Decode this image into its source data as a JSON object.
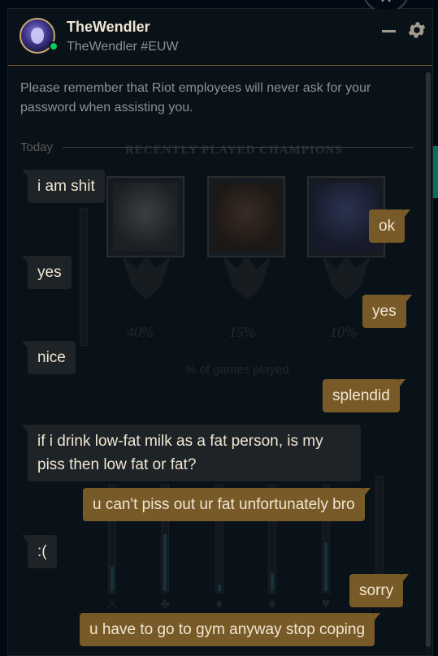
{
  "header": {
    "display_name": "TheWendler",
    "riot_id": "TheWendler #EUW",
    "status_color": "#0acb63",
    "minimize_icon": "minus-icon",
    "settings_icon": "gear-icon",
    "close_icon": "close-icon"
  },
  "notice": "Please remember that Riot employees will never ask for your password when assisting you.",
  "date_divider": "Today",
  "background_panel": {
    "title": "RECENTLY PLAYED CHAMPIONS",
    "percentages": [
      "40%",
      "15%",
      "10%"
    ],
    "caption": "% of games played"
  },
  "messages": [
    {
      "from": "them",
      "text": "i am shit"
    },
    {
      "from": "me",
      "text": "ok"
    },
    {
      "from": "them",
      "text": "yes"
    },
    {
      "from": "me",
      "text": "yes"
    },
    {
      "from": "them",
      "text": "nice"
    },
    {
      "from": "me",
      "text": "splendid"
    },
    {
      "from": "them",
      "text": "if i drink low-fat milk as a fat person, is my piss then low fat or fat?"
    },
    {
      "from": "me",
      "text": "u can't piss out ur fat unfortunately bro"
    },
    {
      "from": "them",
      "text": ":("
    },
    {
      "from": "me",
      "text": "sorry"
    },
    {
      "from": "me",
      "text": "u have to go to gym anyway stop coping"
    }
  ],
  "colors": {
    "accent_gold": "#785a28",
    "incoming_bubble": "#1e2328",
    "text": "#f0e6d2",
    "muted_text": "#8b9196"
  }
}
